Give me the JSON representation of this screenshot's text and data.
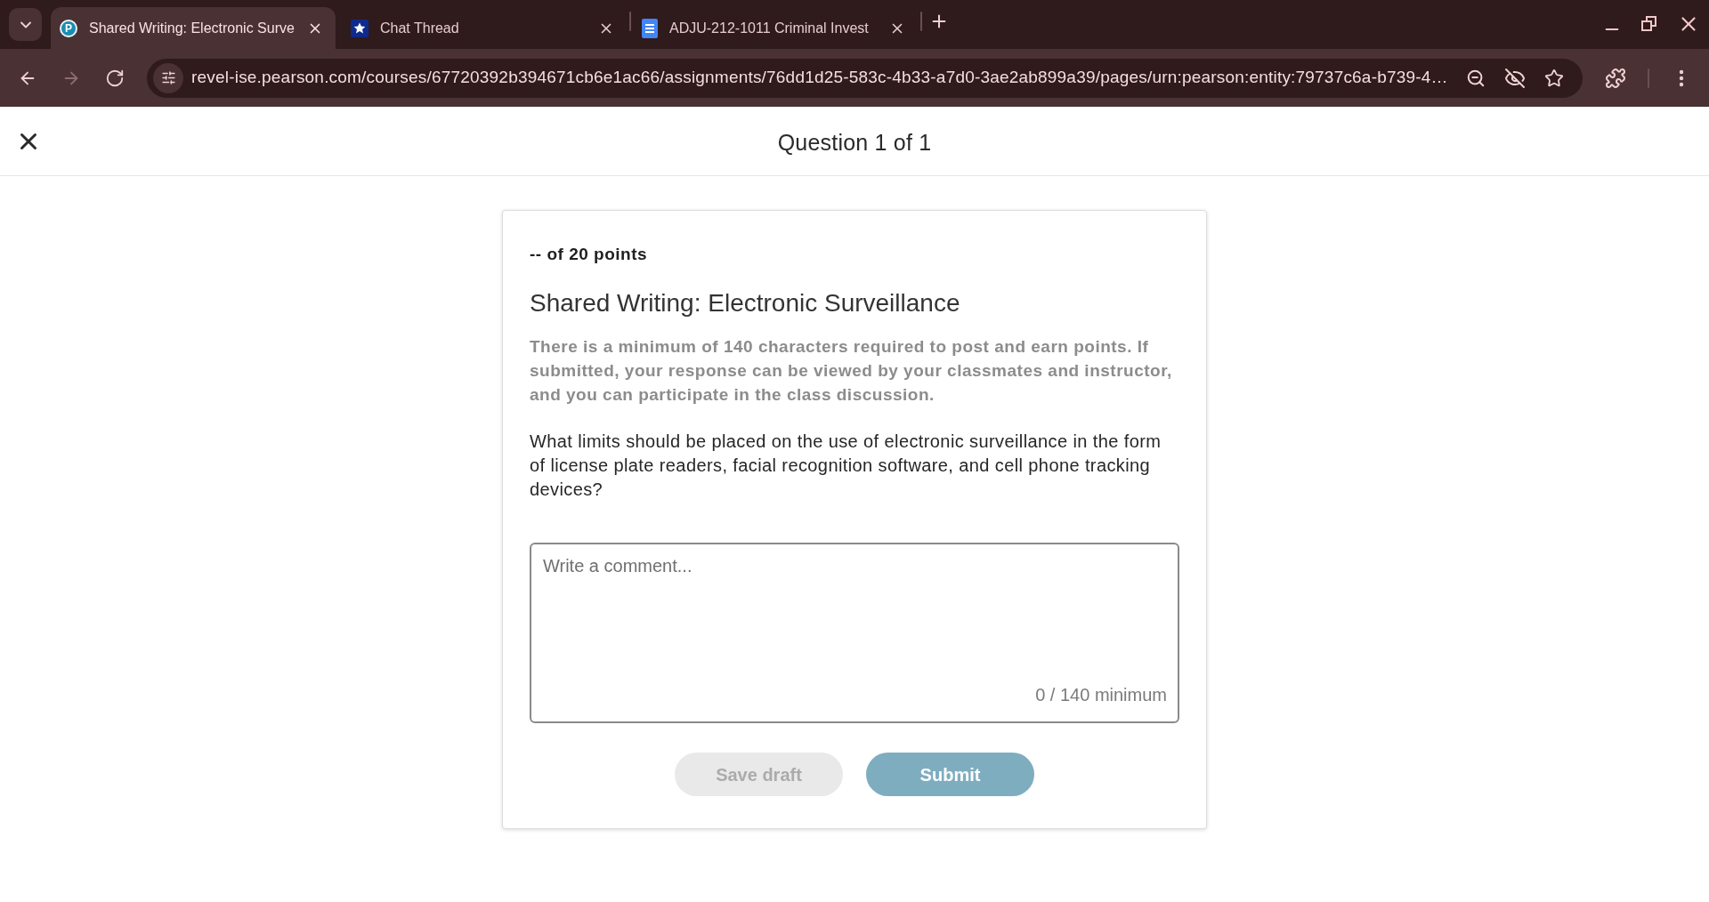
{
  "browser": {
    "tabs": [
      {
        "kind": "letter-logo",
        "icon_text": "P",
        "title": "Shared Writing: Electronic Surve",
        "selected": true
      },
      {
        "kind": "star",
        "title": "Chat Thread",
        "selected": false
      },
      {
        "kind": "document",
        "title": "ADJU-212-1011 Criminal Invest",
        "selected": false
      }
    ],
    "nav_buttons": [
      {
        "kind": "back",
        "disabled": false
      },
      {
        "kind": "forward",
        "disabled": true
      },
      {
        "kind": "reload",
        "disabled": false
      }
    ],
    "address_bar": {
      "url": "revel-ise.pearson.com/courses/67720392b394671cb6e1ac66/assignments/76dd1d25-583c-4b33-a7d0-3ae2ab899a39/pages/urn:pearson:entity:79737c6a-b739-4…"
    }
  },
  "header": {
    "title": "Question 1 of 1"
  },
  "card": {
    "points": "-- of 20 points",
    "title": "Shared Writing: Electronic Surveillance",
    "instructions": "There is a minimum of 140 characters required to post and earn points. If submitted, your response can be viewed by your classmates and instructor, and you can participate in the class discussion.",
    "question": "What limits should be placed on the use of electronic surveillance in the form of license plate readers, facial recognition software, and cell phone tracking devices?",
    "comment": {
      "placeholder": "Write a comment...",
      "counter": "0 / 140 minimum"
    },
    "buttons": [
      {
        "kind": "secondary",
        "label": "Save draft",
        "disabled": true
      },
      {
        "kind": "primary",
        "label": "Submit",
        "disabled": true
      }
    ]
  }
}
